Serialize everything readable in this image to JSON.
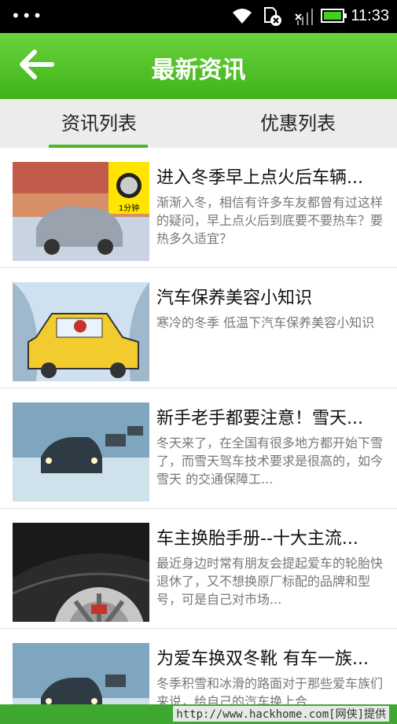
{
  "status_bar": {
    "dots": "•••",
    "time": "11:33",
    "icons": [
      "wifi-icon",
      "sim-card-x-icon",
      "signal-x-icon",
      "battery-icon"
    ]
  },
  "header": {
    "title": "最新资讯",
    "back_icon": "back-arrow-icon"
  },
  "tabs": [
    {
      "label": "资讯列表",
      "selected": true
    },
    {
      "label": "优惠列表",
      "selected": false
    }
  ],
  "news": [
    {
      "title": "进入冬季早上点火后车辆...",
      "desc": "渐渐入冬，相信有许多车友都曾有过这样的疑问，早上点火后到底要不要热车？要热多久适宜？"
    },
    {
      "title": "汽车保养美容小知识",
      "desc": "寒冷的冬季 低温下汽车保养美容小知识"
    },
    {
      "title": "新手老手都要注意！雪天...",
      "desc": "冬天来了，在全国有很多地方都开始下雪了，而雪天驾车技术要求是很高的，如今雪天 的交通保障工..."
    },
    {
      "title": "车主换胎手册--十大主流...",
      "desc": "最近身边时常有朋友会提起爱车的轮胎快退休了，又不想换原厂标配的品牌和型号，可是自己对市场..."
    },
    {
      "title": "为爱车换双冬靴 有车一族...",
      "desc": "冬季积雪和冰滑的路面对于那些爱车族们来说，给自己的汽车换上合"
    }
  ],
  "thumb_labels": {
    "clock": "1分钟"
  },
  "footer": {
    "credit": "http://www.hackhome.com[网侠]提供"
  },
  "colors": {
    "header_green": "#4cb826",
    "footer_green": "#3ea830"
  }
}
